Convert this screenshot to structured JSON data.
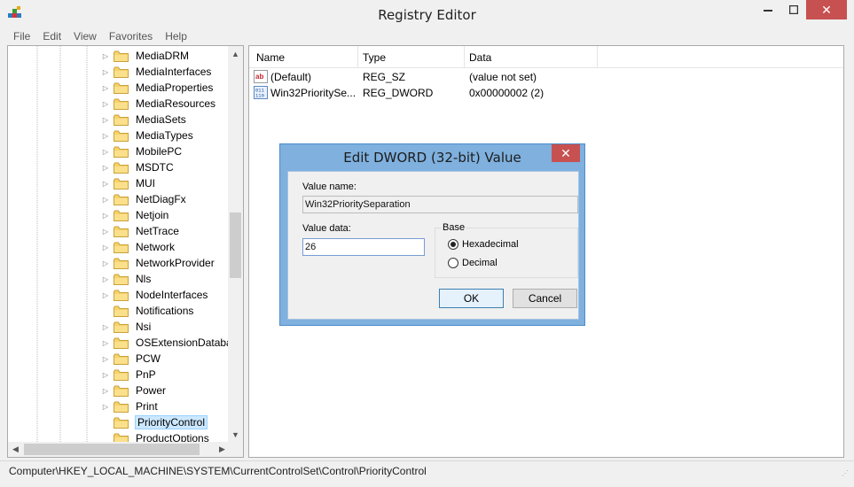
{
  "window": {
    "title": "Registry Editor",
    "minimize": "—",
    "maximize": "□",
    "close": "✕"
  },
  "menu": [
    "File",
    "Edit",
    "View",
    "Favorites",
    "Help"
  ],
  "tree": {
    "nodes": [
      {
        "label": "MediaDRM",
        "expandable": true
      },
      {
        "label": "MediaInterfaces",
        "expandable": true
      },
      {
        "label": "MediaProperties",
        "expandable": true
      },
      {
        "label": "MediaResources",
        "expandable": true
      },
      {
        "label": "MediaSets",
        "expandable": true
      },
      {
        "label": "MediaTypes",
        "expandable": true
      },
      {
        "label": "MobilePC",
        "expandable": true
      },
      {
        "label": "MSDTC",
        "expandable": true
      },
      {
        "label": "MUI",
        "expandable": true
      },
      {
        "label": "NetDiagFx",
        "expandable": true
      },
      {
        "label": "Netjoin",
        "expandable": true
      },
      {
        "label": "NetTrace",
        "expandable": true
      },
      {
        "label": "Network",
        "expandable": true
      },
      {
        "label": "NetworkProvider",
        "expandable": true
      },
      {
        "label": "Nls",
        "expandable": true
      },
      {
        "label": "NodeInterfaces",
        "expandable": true
      },
      {
        "label": "Notifications",
        "expandable": false
      },
      {
        "label": "Nsi",
        "expandable": true
      },
      {
        "label": "OSExtensionDatabase",
        "expandable": true
      },
      {
        "label": "PCW",
        "expandable": true
      },
      {
        "label": "PnP",
        "expandable": true
      },
      {
        "label": "Power",
        "expandable": true
      },
      {
        "label": "Print",
        "expandable": true
      },
      {
        "label": "PriorityControl",
        "expandable": false,
        "selected": true
      },
      {
        "label": "ProductOptions",
        "expandable": false
      }
    ]
  },
  "list": {
    "columns": [
      "Name",
      "Type",
      "Data"
    ],
    "rows": [
      {
        "icon": "string-value-icon",
        "name": "(Default)",
        "type": "REG_SZ",
        "data": "(value not set)"
      },
      {
        "icon": "binary-value-icon",
        "name": "Win32PrioritySe...",
        "type": "REG_DWORD",
        "data": "0x00000002 (2)"
      }
    ]
  },
  "status": {
    "path": "Computer\\HKEY_LOCAL_MACHINE\\SYSTEM\\CurrentControlSet\\Control\\PriorityControl"
  },
  "dialog": {
    "title": "Edit DWORD (32-bit) Value",
    "close": "✕",
    "value_name_label": "Value name:",
    "value_name": "Win32PrioritySeparation",
    "value_data_label": "Value data:",
    "value_data": "26",
    "base_label": "Base",
    "hex_label": "Hexadecimal",
    "dec_label": "Decimal",
    "selected_base": "Hexadecimal",
    "ok": "OK",
    "cancel": "Cancel"
  },
  "colors": {
    "accent": "#7fb0de",
    "close_red": "#c75050",
    "selection": "#cce8ff"
  }
}
